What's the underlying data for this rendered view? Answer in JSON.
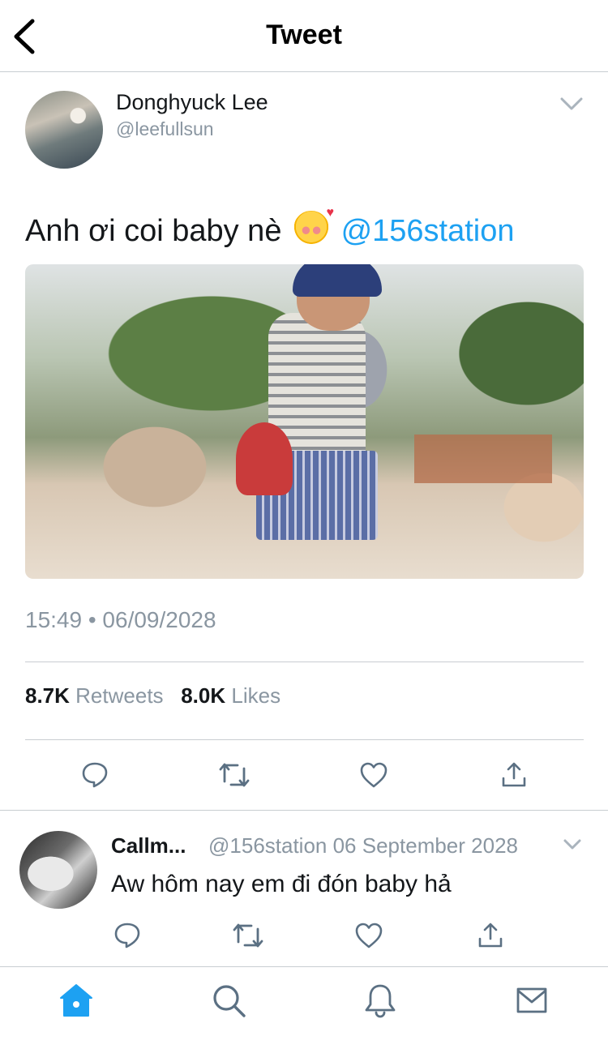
{
  "header": {
    "title": "Tweet"
  },
  "tweet": {
    "author_name": "Donghyuck Lee",
    "author_handle": "@leefullsun",
    "text": "Anh ơi coi baby nè",
    "emoji": "smiling-face-with-hearts-emoji",
    "mention": "@156station",
    "image": "photo-child-with-scooter",
    "timestamp": "15:49 • 06/09/2028",
    "retweets_count": "8.7K",
    "retweets_label": "Retweets",
    "likes_count": "8.0K",
    "likes_label": "Likes"
  },
  "reply": {
    "author_name": "Callm...",
    "meta": "@156station 06 September 2028",
    "text": "Aw hôm nay em đi đón baby hả"
  },
  "icons": {
    "back": "chevron-left-icon",
    "caret": "chevron-down-icon",
    "reply": "reply-icon",
    "retweet": "retweet-icon",
    "like": "heart-icon",
    "share": "share-icon",
    "home": "home-icon",
    "search": "search-icon",
    "notifications": "bell-icon",
    "messages": "mail-icon"
  },
  "colors": {
    "accent": "#1da1f2",
    "text": "#14171a",
    "secondary": "#8a96a1",
    "icon": "#5b7083",
    "divider": "#c8cdd1"
  }
}
